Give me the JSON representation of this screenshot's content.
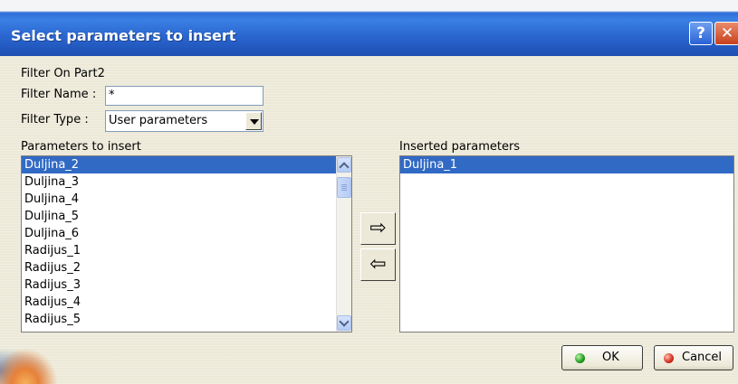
{
  "window": {
    "title": "Select parameters to insert",
    "help_label": "?",
    "close_label": "✕"
  },
  "filter": {
    "heading": "Filter On Part2",
    "name_label": "Filter Name :",
    "name_value": "*",
    "type_label": "Filter Type :",
    "type_value": "User parameters"
  },
  "available": {
    "label": "Parameters to insert",
    "items": [
      "Duljina_2",
      "Duljina_3",
      "Duljina_4",
      "Duljina_5",
      "Duljina_6",
      "Radijus_1",
      "Radijus_2",
      "Radijus_3",
      "Radijus_4",
      "Radijus_5"
    ],
    "selected_index": 0
  },
  "inserted": {
    "label": "Inserted parameters",
    "items": [
      "Duljina_1"
    ],
    "selected_index": 0
  },
  "transfer": {
    "add_glyph": "⇨",
    "remove_glyph": "⇦"
  },
  "buttons": {
    "ok_label": "OK",
    "cancel_label": "Cancel"
  },
  "colors": {
    "title_bar": "#2a66cf",
    "selection": "#316ac5",
    "ok_dot": "#1e9a1e",
    "cancel_dot": "#d42a1c"
  }
}
